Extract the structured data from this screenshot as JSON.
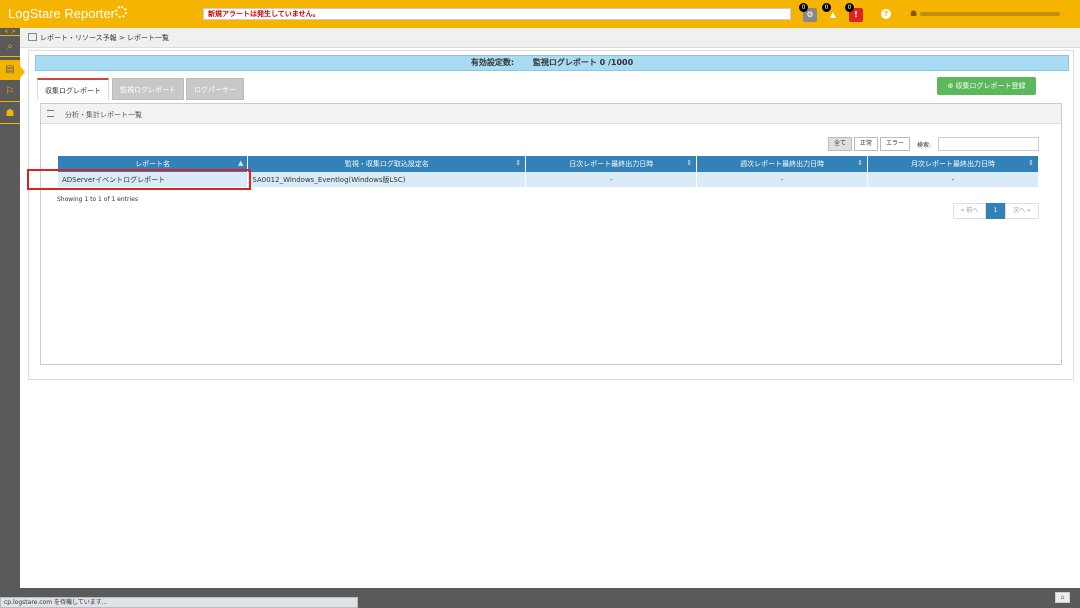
{
  "app": {
    "title": "LogStare Reporter"
  },
  "header": {
    "alert_message": "新規アラートは発生していません。",
    "badges": [
      {
        "icon": "info-icon",
        "count": "0",
        "color": "#888888"
      },
      {
        "icon": "warning-icon",
        "count": "0",
        "color": "#f5b400"
      },
      {
        "icon": "error-icon",
        "count": "0",
        "color": "#dd2222"
      }
    ],
    "help_glyph": "?"
  },
  "sidebar": {
    "items": [
      {
        "icon": "search-icon",
        "glyph": "⌕"
      },
      {
        "icon": "report-icon",
        "glyph": "▤"
      },
      {
        "icon": "alert-icon",
        "glyph": "⚐"
      },
      {
        "icon": "users-icon",
        "glyph": "☗"
      }
    ],
    "arrows": "< >"
  },
  "breadcrumb": {
    "text": "レポート・リソース予報 > レポート一覧"
  },
  "settings": {
    "label": "有効設定数:",
    "value": "監視ログレポート 0 /1000"
  },
  "tabs": [
    {
      "label": "収集ログレポート",
      "active": true
    },
    {
      "label": "監視ログレポート",
      "active": false
    },
    {
      "label": "ログパーサー",
      "active": false
    }
  ],
  "register_button": "⊕ 収集ログレポート登録",
  "panel": {
    "title": "分析・集計レポート一覧"
  },
  "filters": [
    {
      "label": "全て",
      "active": true
    },
    {
      "label": "正常",
      "active": false
    },
    {
      "label": "エラー",
      "active": false
    }
  ],
  "search": {
    "label": "検索:",
    "value": ""
  },
  "table": {
    "columns": [
      "レポート名",
      "監視・収集ログ取込設定名",
      "日次レポート最終出力日時",
      "週次レポート最終出力日時",
      "月次レポート最終出力日時"
    ],
    "rows": [
      [
        "ADServerイベントログレポート",
        "SA0012_Windows_Eventlog(Windows版LSC)",
        "-",
        "-",
        "-"
      ]
    ]
  },
  "showing": "Showing 1 to 1 of 1 entries",
  "pager": {
    "prev": "« 前へ",
    "page": "1",
    "next": "次へ »"
  },
  "status_url": "cp.logstare.com を待機しています..."
}
